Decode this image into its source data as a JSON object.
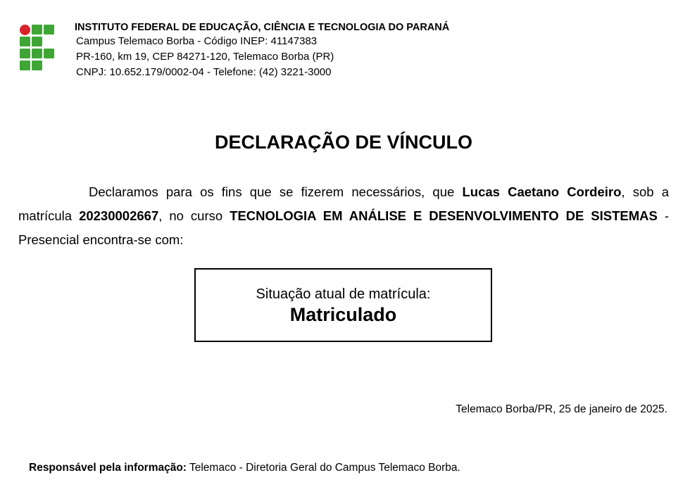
{
  "header": {
    "institution": "INSTITUTO FEDERAL DE EDUCAÇÃO, CIÊNCIA E TECNOLOGIA DO PARANÁ",
    "campus_line": "Campus Telemaco Borba - Código INEP: 41147383",
    "address_line": "PR-160, km 19, CEP 84271-120, Telemaco Borba (PR)",
    "cnpj_line": "CNPJ: 10.652.179/0002-04 - Telefone: (42) 3221-3000"
  },
  "logo": {
    "icon": "ifpr-logo-icon",
    "red": "#d8232a",
    "green": "#3fa535"
  },
  "document": {
    "title": "DECLARAÇÃO DE VÍNCULO",
    "text_part1": "Declaramos para os fins que se fizerem necessários, que ",
    "student_name": "Lucas Caetano Cordeiro",
    "text_part2": ", sob a matrícula ",
    "registration": "20230002667",
    "text_part3": ", no curso ",
    "course": "TECNOLOGIA EM ANÁLISE E DESENVOLVIMENTO DE SISTEMAS",
    "text_part4": " - Presencial encontra-se com:"
  },
  "status": {
    "label": "Situação atual de matrícula:",
    "value": "Matriculado"
  },
  "footer": {
    "date_line": "Telemaco Borba/PR, 25 de janeiro de 2025.",
    "responsible_label": "Responsável pela informação:",
    "responsible_text": " Telemaco - Diretoria Geral do Campus Telemaco Borba."
  }
}
